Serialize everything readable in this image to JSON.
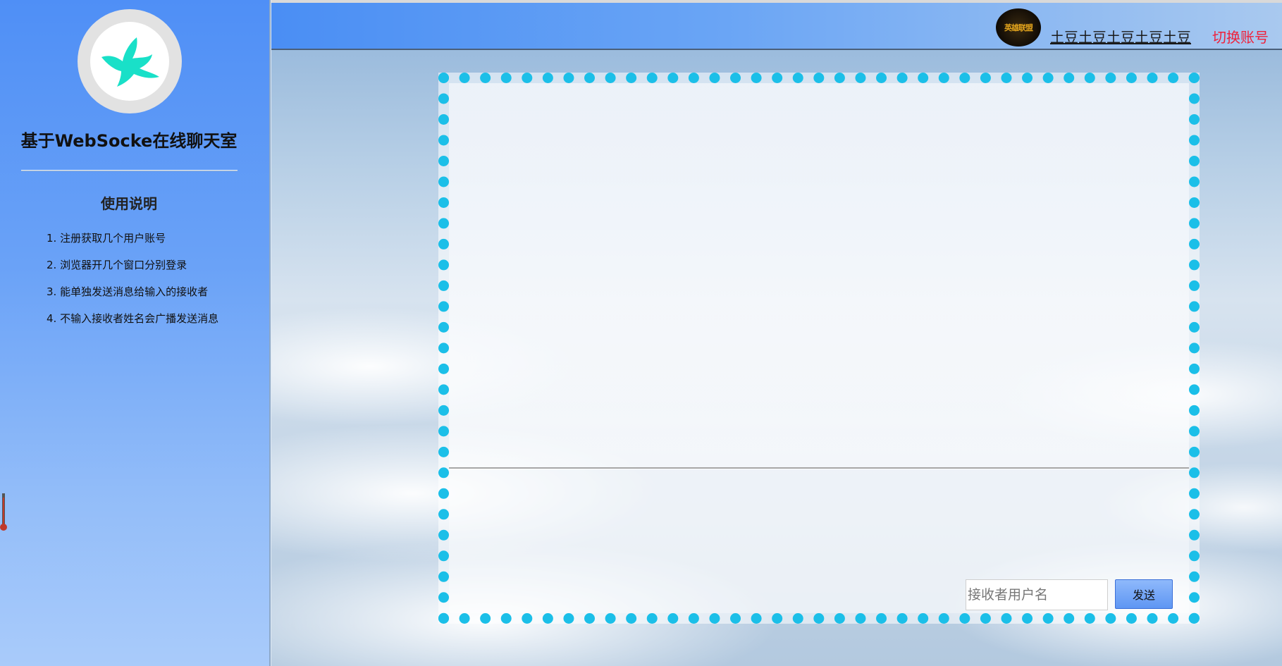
{
  "sidebar": {
    "app_title": "基于WebSocke在线聊天室",
    "usage_title": "使用说明",
    "usage_items": [
      "1. 注册获取几个用户账号",
      "2. 浏览器开几个窗口分别登录",
      "3. 能单独发送消息给输入的接收者",
      "4. 不输入接收者姓名会广播发送消息"
    ]
  },
  "header": {
    "avatar_badge_text": "英雄联盟",
    "username": "土豆土豆土豆土豆土豆",
    "switch_account_label": "切换账号"
  },
  "composer": {
    "receiver_placeholder": "接收者用户名",
    "receiver_value": "",
    "send_label": "发送"
  },
  "icons": {
    "logo": "dove-icon",
    "side_widget": "thermometer-icon"
  },
  "colors": {
    "sidebar_top": "#4f8ff6",
    "frame_dots": "#1bbfe8",
    "logo_bird": "#19e0c8",
    "switch_account": "#f0203a",
    "send_button": "#5e96f3"
  }
}
